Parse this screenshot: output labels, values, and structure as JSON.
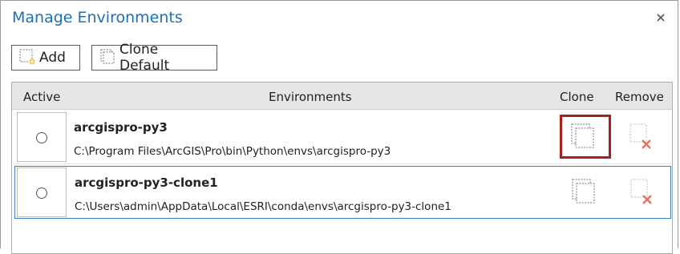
{
  "dialog": {
    "title": "Manage Environments",
    "close_icon": "close-icon"
  },
  "toolbar": {
    "add_label": "Add",
    "add_icon": "add-environment-icon",
    "clone_default_label": "Clone Default",
    "clone_default_icon": "clone-icon"
  },
  "grid": {
    "columns": {
      "active": "Active",
      "environments": "Environments",
      "clone": "Clone",
      "remove": "Remove"
    },
    "rows": [
      {
        "name": "arcgispro-py3",
        "path": "C:\\Program Files\\ArcGIS\\Pro\\bin\\Python\\envs\\arcgispro-py3",
        "active": false,
        "clone_icon": "clone-icon",
        "remove_icon": "remove-icon",
        "remove_enabled": false,
        "clone_highlighted": true
      },
      {
        "name": "arcgispro-py3-clone1",
        "path": "C:\\Users\\admin\\AppData\\Local\\ESRI\\conda\\envs\\arcgispro-py3-clone1",
        "active": false,
        "clone_icon": "clone-icon",
        "remove_icon": "remove-icon",
        "remove_enabled": false,
        "clone_highlighted": false
      }
    ]
  },
  "colors": {
    "title": "#1f6fb2",
    "header_bg": "#e6e6e6",
    "selected_border": "#3c7fc1",
    "highlight": "#a3231c",
    "remove_x": "#e8735c"
  }
}
